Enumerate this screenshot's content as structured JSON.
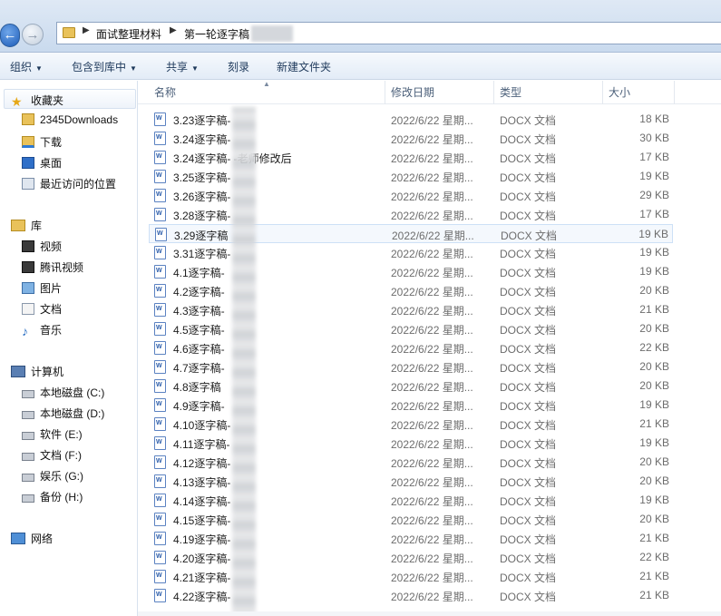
{
  "address": {
    "crumbs": [
      "面试整理材料",
      "第一轮逐字稿"
    ]
  },
  "toolbar": {
    "organize": "组织",
    "include_library": "包含到库中",
    "share": "共享",
    "burn": "刻录",
    "new_folder": "新建文件夹"
  },
  "nav": {
    "favorites": "收藏夹",
    "fav_items": [
      "2345Downloads",
      "下载",
      "桌面",
      "最近访问的位置"
    ],
    "libraries": "库",
    "lib_items": [
      "视频",
      "腾讯视频",
      "图片",
      "文档",
      "音乐"
    ],
    "computer": "计算机",
    "drives": [
      "本地磁盘 (C:)",
      "本地磁盘 (D:)",
      "软件 (E:)",
      "文档 (F:)",
      "娱乐 (G:)",
      "备份 (H:)"
    ],
    "network": "网络"
  },
  "columns": {
    "name": "名称",
    "date": "修改日期",
    "type": "类型",
    "size": "大小"
  },
  "files": [
    {
      "name": "3.23逐字稿-",
      "date": "2022/6/22 星期...",
      "type": "DOCX 文档",
      "size": "18 KB"
    },
    {
      "name": "3.24逐字稿-",
      "date": "2022/6/22 星期...",
      "type": "DOCX 文档",
      "size": "30 KB"
    },
    {
      "name": "3.24逐字稿-       -老师修改后",
      "date": "2022/6/22 星期...",
      "type": "DOCX 文档",
      "size": "17 KB"
    },
    {
      "name": "3.25逐字稿-",
      "date": "2022/6/22 星期...",
      "type": "DOCX 文档",
      "size": "19 KB"
    },
    {
      "name": "3.26逐字稿-",
      "date": "2022/6/22 星期...",
      "type": "DOCX 文档",
      "size": "29 KB"
    },
    {
      "name": "3.28逐字稿-",
      "date": "2022/6/22 星期...",
      "type": "DOCX 文档",
      "size": "17 KB"
    },
    {
      "name": "3.29逐字稿",
      "date": "2022/6/22 星期...",
      "type": "DOCX 文档",
      "size": "19 KB"
    },
    {
      "name": "3.31逐字稿-",
      "date": "2022/6/22 星期...",
      "type": "DOCX 文档",
      "size": "19 KB"
    },
    {
      "name": "4.1逐字稿-",
      "date": "2022/6/22 星期...",
      "type": "DOCX 文档",
      "size": "19 KB"
    },
    {
      "name": "4.2逐字稿-",
      "date": "2022/6/22 星期...",
      "type": "DOCX 文档",
      "size": "20 KB"
    },
    {
      "name": "4.3逐字稿-",
      "date": "2022/6/22 星期...",
      "type": "DOCX 文档",
      "size": "21 KB"
    },
    {
      "name": "4.5逐字稿-",
      "date": "2022/6/22 星期...",
      "type": "DOCX 文档",
      "size": "20 KB"
    },
    {
      "name": "4.6逐字稿-",
      "date": "2022/6/22 星期...",
      "type": "DOCX 文档",
      "size": "22 KB"
    },
    {
      "name": "4.7逐字稿-",
      "date": "2022/6/22 星期...",
      "type": "DOCX 文档",
      "size": "20 KB"
    },
    {
      "name": "4.8逐字稿",
      "date": "2022/6/22 星期...",
      "type": "DOCX 文档",
      "size": "20 KB"
    },
    {
      "name": "4.9逐字稿-",
      "date": "2022/6/22 星期...",
      "type": "DOCX 文档",
      "size": "19 KB"
    },
    {
      "name": "4.10逐字稿-",
      "date": "2022/6/22 星期...",
      "type": "DOCX 文档",
      "size": "21 KB"
    },
    {
      "name": "4.11逐字稿-",
      "date": "2022/6/22 星期...",
      "type": "DOCX 文档",
      "size": "19 KB"
    },
    {
      "name": "4.12逐字稿-",
      "date": "2022/6/22 星期...",
      "type": "DOCX 文档",
      "size": "20 KB"
    },
    {
      "name": "4.13逐字稿-",
      "date": "2022/6/22 星期...",
      "type": "DOCX 文档",
      "size": "20 KB"
    },
    {
      "name": "4.14逐字稿-",
      "date": "2022/6/22 星期...",
      "type": "DOCX 文档",
      "size": "19 KB"
    },
    {
      "name": "4.15逐字稿-",
      "date": "2022/6/22 星期...",
      "type": "DOCX 文档",
      "size": "20 KB"
    },
    {
      "name": "4.19逐字稿-",
      "date": "2022/6/22 星期...",
      "type": "DOCX 文档",
      "size": "21 KB"
    },
    {
      "name": "4.20逐字稿-",
      "date": "2022/6/22 星期...",
      "type": "DOCX 文档",
      "size": "22 KB"
    },
    {
      "name": "4.21逐字稿-",
      "date": "2022/6/22 星期...",
      "type": "DOCX 文档",
      "size": "21 KB"
    },
    {
      "name": "4.22逐字稿-",
      "date": "2022/6/22 星期...",
      "type": "DOCX 文档",
      "size": "21 KB"
    }
  ]
}
